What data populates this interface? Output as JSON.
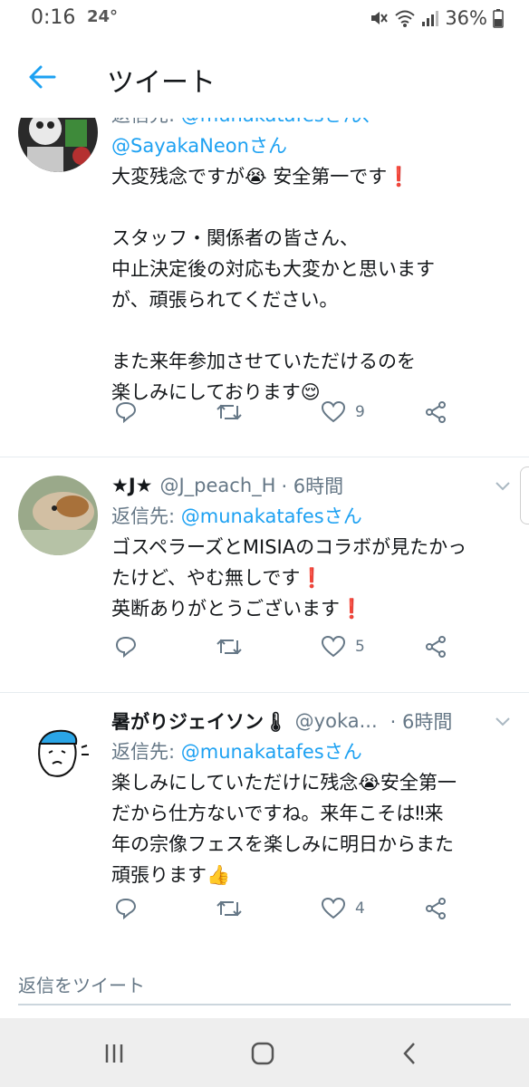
{
  "status_bar": {
    "time": "0:16",
    "notif": "24°",
    "battery": "36%"
  },
  "header": {
    "title": "ツイート"
  },
  "tweets": [
    {
      "reply_to_label": "返信先:",
      "reply_to_mentions": "@munakatafesさん、",
      "mention_line": "@SayakaNeonさん",
      "text": "大変残念ですが😭 安全第一です❗\n\nスタッフ・関係者の皆さん、\n中止決定後の対応も大変かと思います\nが、頑張られてください。\n\nまた来年参加させていただけるのを\n楽しみにしております😌",
      "like_count": "9"
    },
    {
      "name": "★J★",
      "handle": "@J_peach_H",
      "time": "· 6時間",
      "reply_to_label": "返信先:",
      "reply_to_mentions": "@munakatafesさん",
      "text": "ゴスペラーズとMISIAのコラボが見たかっ\nたけど、やむ無しです❗\n英断ありがとうございます❗",
      "like_count": "5"
    },
    {
      "name": "暑がりジェイソン🌡",
      "handle": "@yoka...",
      "time": "· 6時間",
      "reply_to_label": "返信先:",
      "reply_to_mentions": "@munakatafesさん",
      "text": "楽しみにしていただけに残念😭安全第一\nだから仕方ないですね。来年こそは‼来\n年の宗像フェスを楽しみに明日からまた\n頑張ります👍",
      "like_count": "4"
    }
  ],
  "reply_bar": {
    "placeholder": "返信をツイート"
  },
  "colors": {
    "accent": "#1da1f2",
    "secondary_text": "#657786",
    "divider": "#e6ecf0"
  }
}
